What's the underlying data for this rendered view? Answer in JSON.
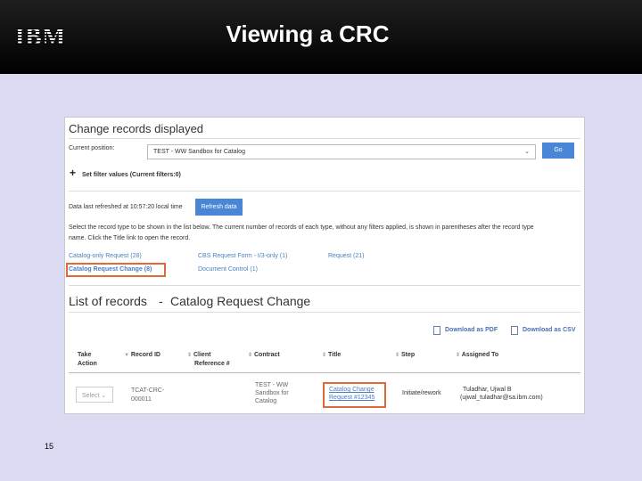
{
  "slide": {
    "title": "Viewing a CRC",
    "logo": "IBM",
    "page_number": "15"
  },
  "app": {
    "heading": "Change records displayed",
    "current_position_label": "Current position:",
    "current_position_value": "TEST - WW Sandbox for Catalog",
    "go_label": "Go",
    "filter_label": "Set filter values (Current filters:0)",
    "refreshed_text": "Data last refreshed at 10:57:20 local time",
    "refresh_label": "Refresh data",
    "instructions_1": "Select the record type to be shown in the list below. The current number of records of each type, without any filters applied, is shown in parentheses after the record type",
    "instructions_2": "name. Click the Title link to open the record.",
    "record_types": [
      "Catalog-only Request (28)",
      "CBS Request Form - I/3-only (1)",
      "Request (21)",
      "Catalog Request Change (8)",
      "Document Control (1)"
    ],
    "list_heading": "List of records",
    "list_sep": "-",
    "list_type": "Catalog Request Change",
    "download_pdf": "Download as PDF",
    "download_csv": "Download as CSV",
    "columns": {
      "take_action_1": "Take",
      "take_action_2": "Action",
      "record_id": "Record ID",
      "client_ref_1": "Client",
      "client_ref_2": "Reference #",
      "contract": "Contract",
      "title": "Title",
      "step": "Step",
      "assigned_to": "Assigned To"
    },
    "row": {
      "select_label": "Select",
      "record_id_1": "TCAT-CRC-",
      "record_id_2": "000011",
      "contract_1": "TEST - WW",
      "contract_2": "Sandbox for",
      "contract_3": "Catalog",
      "title_1": "Catalog Change",
      "title_2": "Request #12345",
      "step": "Initiate/rework",
      "assigned_1": "Tuladhar, Ujwal B",
      "assigned_2": "(ujwal_tuladhar@sa.ibm.com)"
    },
    "colors": {
      "accent": "#4a86d6",
      "highlight": "#e0693a",
      "link": "#4a7fc1"
    }
  }
}
